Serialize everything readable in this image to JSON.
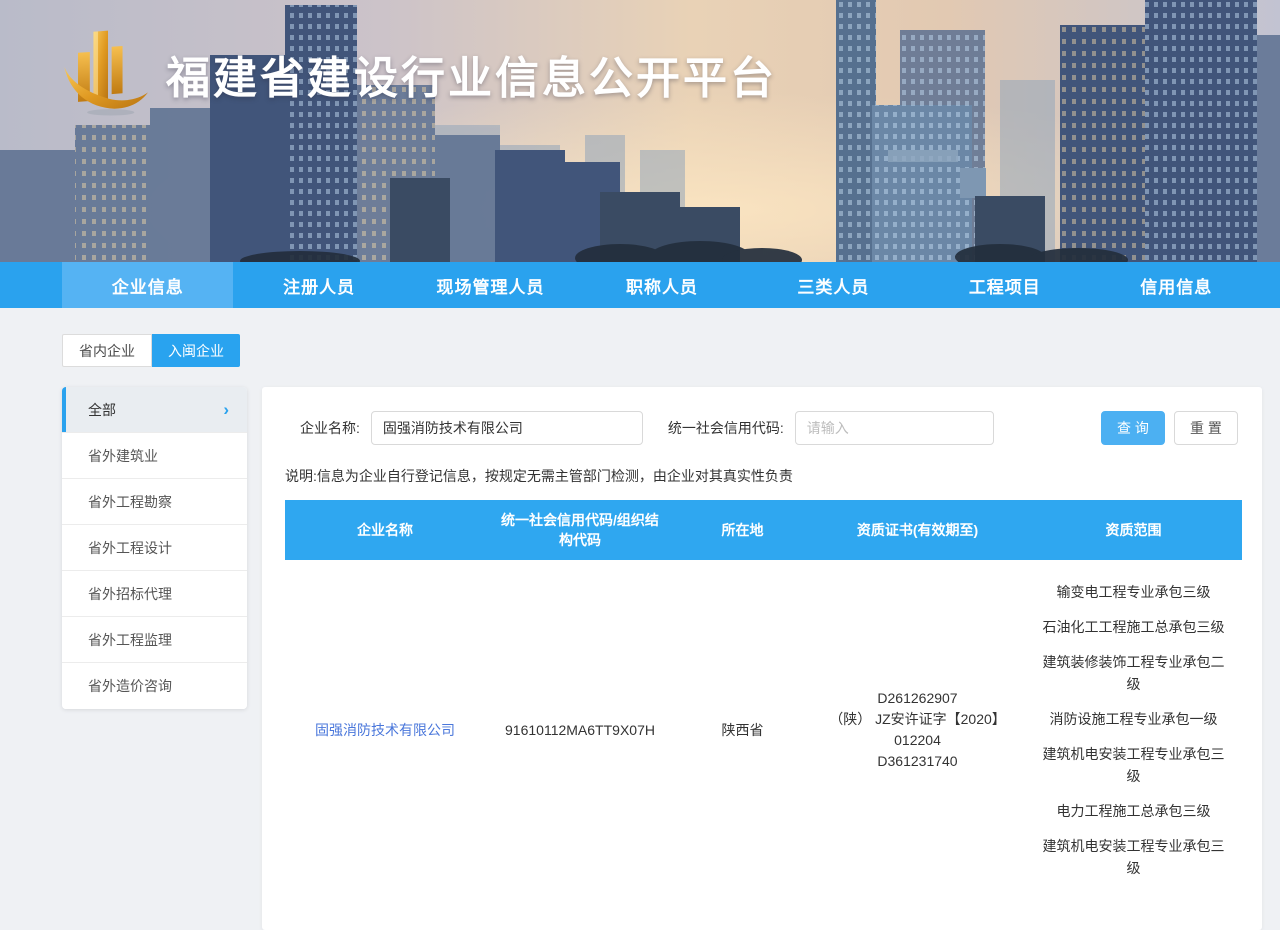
{
  "header": {
    "title": "福建省建设行业信息公开平台"
  },
  "nav": {
    "tabs": [
      {
        "label": "企业信息",
        "active": true
      },
      {
        "label": "注册人员",
        "active": false
      },
      {
        "label": "现场管理人员",
        "active": false
      },
      {
        "label": "职称人员",
        "active": false
      },
      {
        "label": "三类人员",
        "active": false
      },
      {
        "label": "工程项目",
        "active": false
      },
      {
        "label": "信用信息",
        "active": false
      }
    ]
  },
  "subtabs": {
    "province_inside": "省内企业",
    "province_enter": "入闽企业"
  },
  "sidebar": {
    "items": [
      {
        "label": "全部",
        "active": true
      },
      {
        "label": "省外建筑业",
        "active": false
      },
      {
        "label": "省外工程勘察",
        "active": false
      },
      {
        "label": "省外工程设计",
        "active": false
      },
      {
        "label": "省外招标代理",
        "active": false
      },
      {
        "label": "省外工程监理",
        "active": false
      },
      {
        "label": "省外造价咨询",
        "active": false
      }
    ]
  },
  "search": {
    "company_label": "企业名称:",
    "company_value": "固强消防技术有限公司",
    "credit_label": "统一社会信用代码:",
    "credit_placeholder": "请输入",
    "query_button": "查 询",
    "reset_button": "重 置"
  },
  "note": "说明:信息为企业自行登记信息，按规定无需主管部门检测，由企业对其真实性负责",
  "table": {
    "columns": [
      "企业名称",
      "统一社会信用代码/组织结构代码",
      "所在地",
      "资质证书(有效期至)",
      "资质范围"
    ],
    "row": {
      "company": "固强消防技术有限公司",
      "credit_code": "91610112MA6TT9X07H",
      "location": "陕西省",
      "certificates": [
        "D261262907",
        "（陕） JZ安许证字【2020】012204",
        "D361231740"
      ],
      "qualifications": [
        "输变电工程专业承包三级",
        "石油化工工程施工总承包三级",
        "建筑装修装饰工程专业承包二级",
        "消防设施工程专业承包一级",
        "建筑机电安装工程专业承包三级",
        "电力工程施工总承包三级",
        "建筑机电安装工程专业承包三级"
      ]
    }
  },
  "colors": {
    "navbar_blue": "#2AA2EE",
    "active_tab_blue": "#55B3F3",
    "table_header_blue": "#2FA7F0",
    "link_blue": "#4A77DB",
    "logo_gold": "#D99021"
  }
}
